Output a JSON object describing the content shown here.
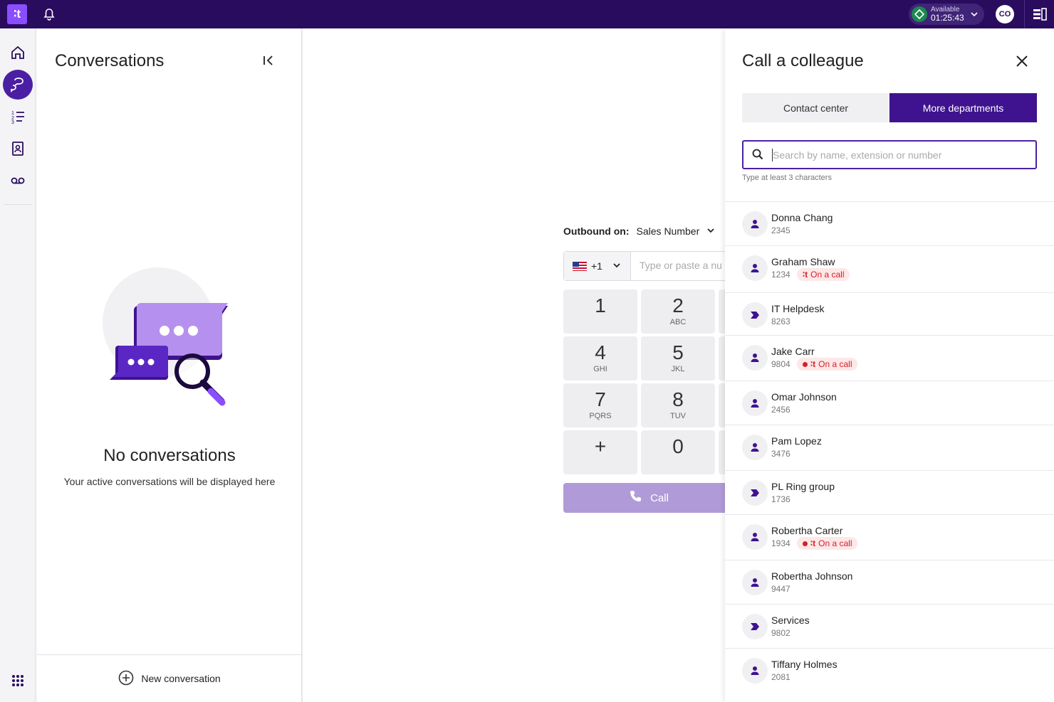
{
  "topbar": {
    "logo": "∶t",
    "status": {
      "label": "Available",
      "time": "01:25:43",
      "color": "#1b8a4e"
    },
    "avatar": "CO"
  },
  "rail": {
    "items": [
      {
        "name": "home",
        "icon": "home-icon"
      },
      {
        "name": "conversations",
        "icon": "conversations-icon",
        "active": true
      },
      {
        "name": "queues",
        "icon": "list-icon"
      },
      {
        "name": "contacts",
        "icon": "contact-book-icon"
      },
      {
        "name": "voicemail",
        "icon": "voicemail-icon"
      }
    ],
    "apps_icon": "grid-icon"
  },
  "conversations": {
    "title": "Conversations",
    "empty_title": "No conversations",
    "empty_subtitle": "Your active conversations will be displayed here",
    "new_label": "New conversation"
  },
  "dialer": {
    "outbound_label": "Outbound on:",
    "outbound_value": "Sales Number",
    "country_code": "+1",
    "input_placeholder": "Type or paste a nu",
    "keys": [
      {
        "num": "1",
        "sub": ""
      },
      {
        "num": "2",
        "sub": "ABC"
      },
      {
        "num": "4",
        "sub": "GHI"
      },
      {
        "num": "5",
        "sub": "JKL"
      },
      {
        "num": "7",
        "sub": "PQRS"
      },
      {
        "num": "8",
        "sub": "TUV"
      },
      {
        "num": "+",
        "sub": ""
      },
      {
        "num": "0",
        "sub": ""
      }
    ],
    "call_label": "Call"
  },
  "colleague": {
    "title": "Call a colleague",
    "tabs": [
      {
        "label": "Contact center",
        "active": false
      },
      {
        "label": "More departments",
        "active": true
      }
    ],
    "search_placeholder": "Search by name, extension or number",
    "hint": "Type at least 3 characters",
    "on_call_label": "On a call",
    "on_call_prefix": "∶t",
    "accent": "#3f138f",
    "contacts": [
      {
        "name": "Donna Chang",
        "ext": "2345",
        "type": "person",
        "on_call": false
      },
      {
        "name": "Graham Shaw",
        "ext": "1234",
        "type": "person",
        "on_call": true,
        "dot": false
      },
      {
        "name": "IT Helpdesk",
        "ext": "8263",
        "type": "group",
        "on_call": false
      },
      {
        "name": "Jake Carr",
        "ext": "9804",
        "type": "person",
        "on_call": true,
        "dot": true
      },
      {
        "name": "Omar Johnson",
        "ext": "2456",
        "type": "person",
        "on_call": false
      },
      {
        "name": "Pam Lopez",
        "ext": "3476",
        "type": "person",
        "on_call": false
      },
      {
        "name": "PL Ring group",
        "ext": "1736",
        "type": "group",
        "on_call": false
      },
      {
        "name": "Robertha Carter",
        "ext": "1934",
        "type": "person",
        "on_call": true,
        "dot": true
      },
      {
        "name": "Robertha Johnson",
        "ext": "9447",
        "type": "person",
        "on_call": false
      },
      {
        "name": "Services",
        "ext": "9802",
        "type": "group",
        "on_call": false
      },
      {
        "name": "Tiffany Holmes",
        "ext": "2081",
        "type": "person",
        "on_call": false
      }
    ]
  }
}
